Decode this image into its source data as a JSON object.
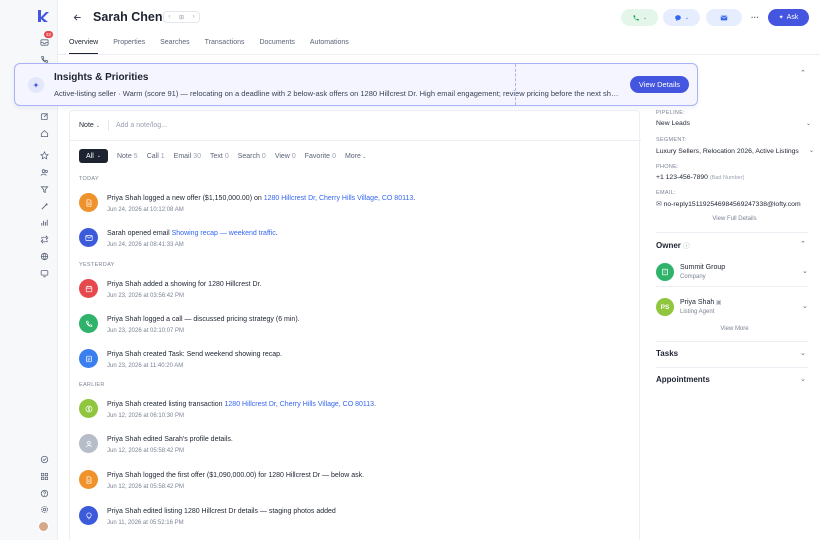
{
  "sidebar": {
    "badge": "32"
  },
  "header": {
    "name": "Sarah Chen",
    "ask_label": "Ask"
  },
  "tabs": [
    "Overview",
    "Properties",
    "Searches",
    "Transactions",
    "Documents",
    "Automations"
  ],
  "insight": {
    "title": "Insights & Priorities",
    "text": "Active-listing seller · Warm (score 91) — relocating on a deadline with 2 below-ask offers on 1280 Hillcrest Dr. High email engagement; review pricing before the next showing.",
    "button": "View Details"
  },
  "note": {
    "type": "Note",
    "placeholder": "Add a note/log..."
  },
  "filters": [
    {
      "label": "All",
      "count": ""
    },
    {
      "label": "Note",
      "count": "5"
    },
    {
      "label": "Call",
      "count": "1"
    },
    {
      "label": "Email",
      "count": "30"
    },
    {
      "label": "Text",
      "count": "0"
    },
    {
      "label": "Search",
      "count": "0"
    },
    {
      "label": "View",
      "count": "0"
    },
    {
      "label": "Favorite",
      "count": "0"
    },
    {
      "label": "More",
      "count": ""
    }
  ],
  "groups": {
    "today": "TODAY",
    "yesterday": "YESTERDAY",
    "earlier": "EARLIER"
  },
  "events": [
    {
      "pre": "Priya Shah logged a new offer ($1,150,000.00) on ",
      "link": "1280 Hillcrest Dr, Cherry Hills Village, CO 80113",
      "post": ".",
      "time": "Jun 24, 2026 at 10:12:08 AM",
      "color": "#f0922b",
      "icon": "offer-icon"
    },
    {
      "pre": "Sarah opened email ",
      "link": "Showing recap — weekend traffic",
      "post": ".",
      "time": "Jun 24, 2026 at 08:41:33 AM",
      "color": "#3b5bdb",
      "icon": "email-icon"
    },
    {
      "pre": "Priya Shah added a showing for 1280 Hillcrest Dr.",
      "link": "",
      "post": "",
      "time": "Jun 23, 2026 at 03:56:42 PM",
      "color": "#e5484d",
      "icon": "calendar-icon"
    },
    {
      "pre": "Priya Shah logged a call — discussed pricing strategy (6 min).",
      "link": "",
      "post": "",
      "time": "Jun 23, 2026 at 02:10:07 PM",
      "color": "#2fb36b",
      "icon": "phone-icon"
    },
    {
      "pre": "Priya Shah created Task: Send weekend showing recap.",
      "link": "",
      "post": "",
      "time": "Jun 23, 2026 at 11:40:20 AM",
      "color": "#3b7ef0",
      "icon": "task-icon"
    },
    {
      "pre": "Priya Shah created listing transaction ",
      "link": "1280 Hillcrest Dr, Cherry Hills Village, CO 80113",
      "post": ".",
      "time": "Jun 12, 2026 at 06:10:30 PM",
      "color": "#8fc63d",
      "icon": "dollar-icon"
    },
    {
      "pre": "Priya Shah edited Sarah's profile details.",
      "link": "",
      "post": "",
      "time": "Jun 12, 2026 at 05:58:42 PM",
      "color": "#b6bcc8",
      "icon": "user-icon"
    },
    {
      "pre": "Priya Shah logged the first offer ($1,090,000.00) for 1280 Hillcrest Dr — below ask.",
      "link": "",
      "post": "",
      "time": "Jun 12, 2026 at 05:58:42 PM",
      "color": "#f0922b",
      "icon": "offer-icon"
    },
    {
      "pre": "Priya Shah edited listing 1280 Hillcrest Dr details — staging photos added",
      "link": "",
      "post": "",
      "time": "Jun 11, 2026 at 05:52:16 PM",
      "color": "#3b5bdb",
      "icon": "bulb-icon"
    }
  ],
  "details": {
    "pipeline_label": "PIPELINE:",
    "pipeline_value": "New Leads",
    "segment_label": "SEGMENT:",
    "segment_value": "Luxury Sellers, Relocation 2026, Active Listings",
    "phone_label": "PHONE:",
    "phone_value": "+1 123-456-7890",
    "phone_note": "(Bad Number)",
    "email_label": "EMAIL:",
    "email_value": "no-reply1511925469845692473​38@lofty.com",
    "view_full": "View Full Details"
  },
  "owner": {
    "title": "Owner",
    "items": [
      {
        "name": "Summit Group",
        "role": "Company",
        "initials": "",
        "color": "#2fb36b"
      },
      {
        "name": "Priya Shah",
        "role": "Listing Agent",
        "initials": "PS",
        "color": "#8fc63d"
      }
    ],
    "view_more": "View More"
  },
  "sections": {
    "tasks": "Tasks",
    "appointments": "Appointments"
  }
}
